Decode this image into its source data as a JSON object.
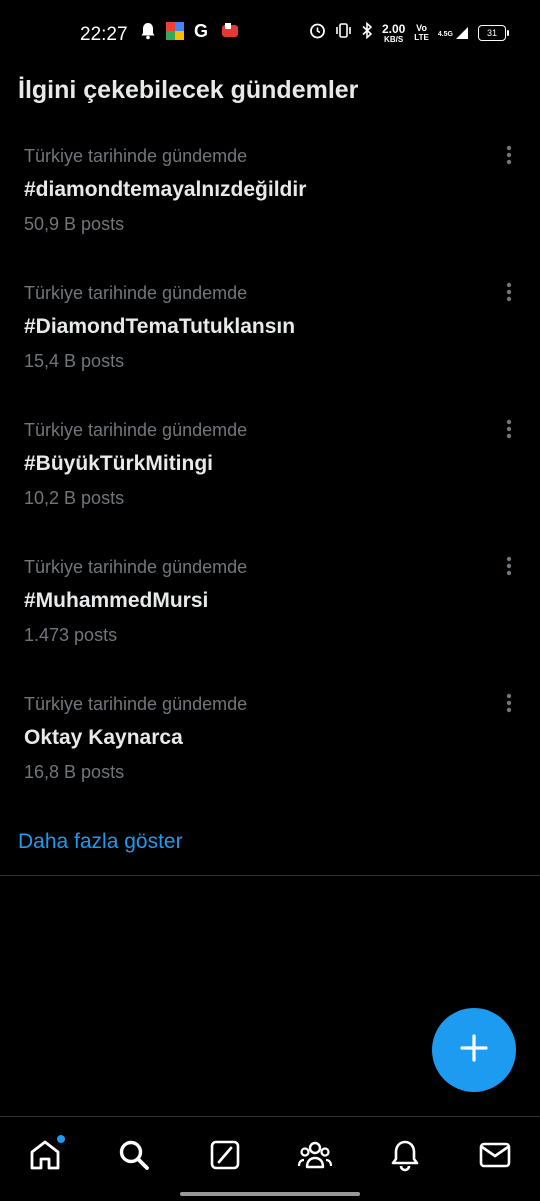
{
  "status_bar": {
    "time": "22:27",
    "network_speed_value": "2.00",
    "network_speed_unit": "KB/S",
    "volte_top": "Vo",
    "volte_bottom": "LTE",
    "signal_label": "4.5G",
    "battery": "31",
    "icons": [
      "bell-icon",
      "app-badge-icon",
      "google-g-icon",
      "app-red-icon",
      "alarm-icon",
      "vibrate-icon",
      "bluetooth-icon",
      "signal-icon"
    ]
  },
  "section": {
    "title": "İlgini çekebilecek gündemler"
  },
  "trends": [
    {
      "context": "Türkiye tarihinde gündemde",
      "name": "#diamondtemayalnızdeğildir",
      "count": "50,9 B posts"
    },
    {
      "context": "Türkiye tarihinde gündemde",
      "name": "#DiamondTemaTutuklansın",
      "count": "15,4 B posts"
    },
    {
      "context": "Türkiye tarihinde gündemde",
      "name": "#BüyükTürkMitingi",
      "count": "10,2 B posts"
    },
    {
      "context": "Türkiye tarihinde gündemde",
      "name": "#MuhammedMursi",
      "count": "1.473 posts"
    },
    {
      "context": "Türkiye tarihinde gündemde",
      "name": "Oktay Kaynarca",
      "count": "16,8 B posts"
    }
  ],
  "show_more": "Daha fazla göster",
  "fab_icon": "plus-icon",
  "bottom_nav": [
    "home-icon",
    "search-icon",
    "grok-icon",
    "communities-icon",
    "notifications-icon",
    "messages-icon"
  ],
  "colors": {
    "accent": "#1d9bf0",
    "background": "#000000",
    "primary_text": "#e7e9ea",
    "secondary_text": "#71767b"
  }
}
